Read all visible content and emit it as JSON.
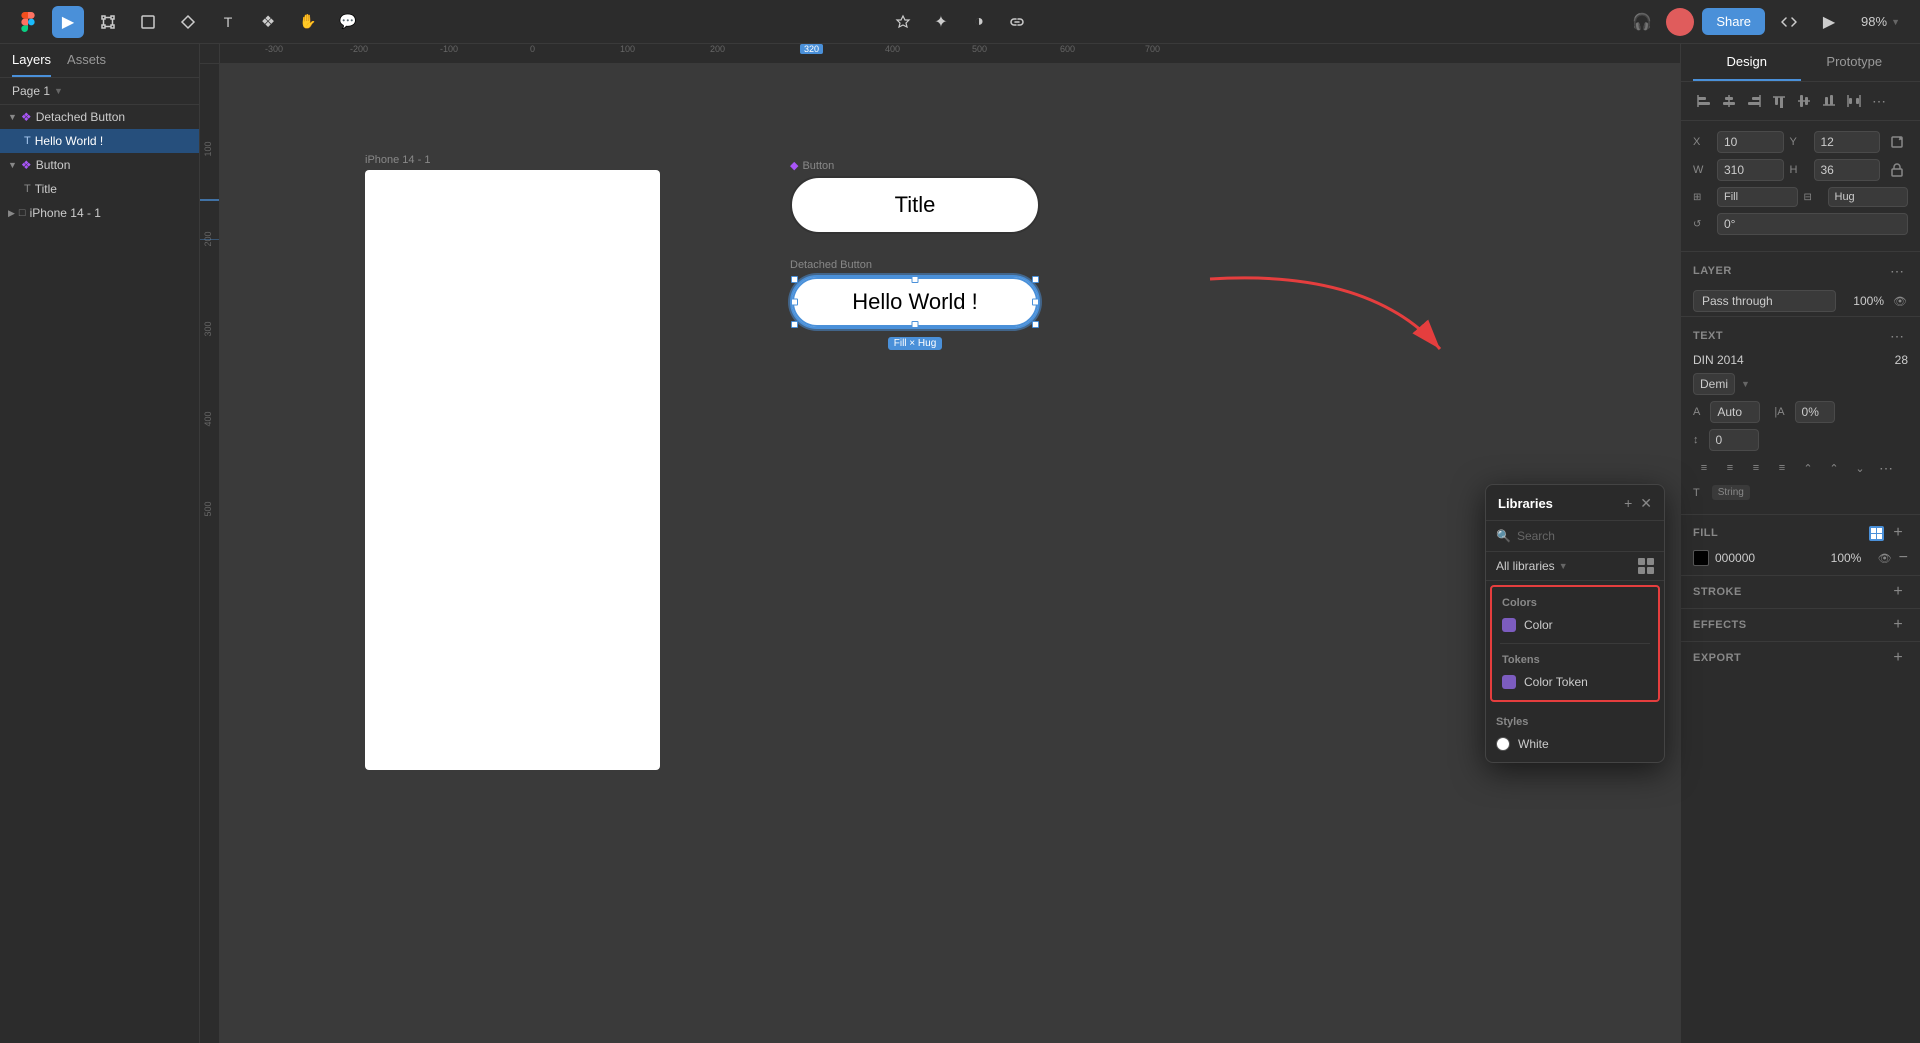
{
  "toolbar": {
    "figma_logo": "F",
    "tools": [
      {
        "name": "select",
        "icon": "▶",
        "label": "Select",
        "active": true
      },
      {
        "name": "frame",
        "icon": "⬜",
        "label": "Frame"
      },
      {
        "name": "shape",
        "icon": "◇",
        "label": "Shape"
      },
      {
        "name": "pen",
        "icon": "✒",
        "label": "Pen"
      },
      {
        "name": "text",
        "icon": "T",
        "label": "Text"
      },
      {
        "name": "components",
        "icon": "❖",
        "label": "Components"
      },
      {
        "name": "hand",
        "icon": "✋",
        "label": "Hand"
      },
      {
        "name": "comment",
        "icon": "💬",
        "label": "Comment"
      }
    ],
    "center_tools": [
      {
        "name": "assets",
        "icon": "◈",
        "label": "Assets"
      },
      {
        "name": "plugins",
        "icon": "✦",
        "label": "Plugins"
      },
      {
        "name": "contrast",
        "icon": "◑",
        "label": "Contrast"
      },
      {
        "name": "link",
        "icon": "🔗",
        "label": "Link"
      }
    ],
    "share_label": "Share",
    "zoom_level": "98%",
    "avatar_initials": ""
  },
  "left_panel": {
    "tabs": [
      {
        "id": "layers",
        "label": "Layers",
        "active": true
      },
      {
        "id": "assets",
        "label": "Assets"
      }
    ],
    "page": "Page 1",
    "layers": [
      {
        "id": "detached-button",
        "label": "Detached Button",
        "indent": 0,
        "icon": "❖",
        "expanded": true,
        "selected": false
      },
      {
        "id": "hello-world",
        "label": "Hello World !",
        "indent": 1,
        "icon": "T",
        "selected": true
      },
      {
        "id": "button",
        "label": "Button",
        "indent": 0,
        "icon": "❖",
        "expanded": true,
        "selected": false
      },
      {
        "id": "title",
        "label": "Title",
        "indent": 1,
        "icon": "T",
        "selected": false
      },
      {
        "id": "iphone-14",
        "label": "iPhone 14 - 1",
        "indent": 0,
        "icon": "□",
        "selected": false
      }
    ]
  },
  "canvas": {
    "iphone_frame_label": "iPhone 14 - 1",
    "button_component_label": "Button",
    "button_title": "Title",
    "detached_button_label": "Detached Button",
    "hello_world_text": "Hello World !",
    "fill_hug_badge": "Fill × Hug"
  },
  "right_panel": {
    "tabs": [
      {
        "id": "design",
        "label": "Design",
        "active": true
      },
      {
        "id": "prototype",
        "label": "Prototype"
      }
    ],
    "position": {
      "x_label": "X",
      "x_value": "10",
      "y_label": "Y",
      "y_value": "12",
      "w_label": "W",
      "w_value": "310",
      "h_label": "H",
      "h_value": "36"
    },
    "constraints": {
      "fill_label": "Fill",
      "fill_value": "Fill",
      "hug_label": "Hug",
      "hug_value": "Hug"
    },
    "rotation": "0°",
    "layer": {
      "section_title": "Layer",
      "mode": "Pass through",
      "opacity": "100%"
    },
    "text": {
      "section_title": "Text",
      "font_name": "DIN 2014",
      "font_weight": "Demi",
      "font_size": "28",
      "tracking_label": "A",
      "tracking_value": "Auto",
      "kern_value": "0%",
      "line_height": "0",
      "string_label": "String"
    },
    "fill": {
      "section_title": "Fill",
      "color": "000000",
      "opacity": "100%"
    },
    "stroke": {
      "section_title": "Stroke"
    },
    "effects": {
      "section_title": "Effects"
    },
    "export": {
      "section_title": "Export"
    }
  },
  "libraries_popup": {
    "title": "Libraries",
    "search_placeholder": "Search",
    "filter_label": "All libraries",
    "sections": [
      {
        "id": "colors",
        "title": "Colors",
        "highlighted": true,
        "items": [
          {
            "id": "color",
            "label": "Color",
            "color": "#7c5cbf"
          }
        ]
      },
      {
        "id": "tokens",
        "title": "Tokens",
        "highlighted": true,
        "items": [
          {
            "id": "color-token",
            "label": "Color Token",
            "color": "#7c5cbf"
          }
        ]
      },
      {
        "id": "styles",
        "title": "Styles",
        "highlighted": false,
        "items": [
          {
            "id": "white",
            "label": "White",
            "color": "#ffffff",
            "is_circle": true
          }
        ]
      }
    ]
  },
  "ruler": {
    "ticks": [
      "-300",
      "-200",
      "-100",
      "0",
      "100",
      "200",
      "300"
    ],
    "highlight_pos": "320"
  }
}
